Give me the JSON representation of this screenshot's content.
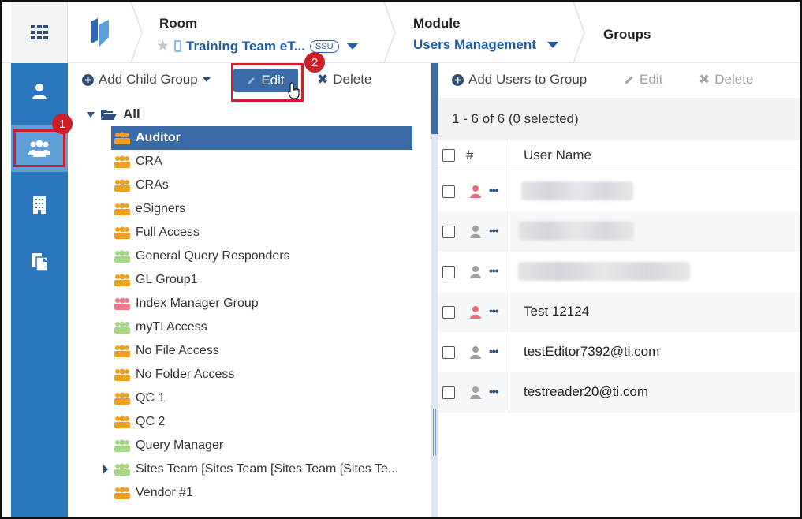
{
  "header": {
    "room_title": "Room",
    "room_value": "Training Team eT...",
    "room_badge": "SSU",
    "module_title": "Module",
    "module_value": "Users Management",
    "page_title": "Groups"
  },
  "badges": {
    "one": "1",
    "two": "2"
  },
  "tree_toolbar": {
    "add_child_group": "Add Child Group",
    "edit": "Edit",
    "delete": "Delete"
  },
  "tree": {
    "root": "All",
    "items": [
      {
        "label": "Auditor",
        "color": "#f0a020"
      },
      {
        "label": "CRA",
        "color": "#f0a020"
      },
      {
        "label": "CRAs",
        "color": "#f0a020"
      },
      {
        "label": "eSigners",
        "color": "#f0a020"
      },
      {
        "label": "Full Access",
        "color": "#f0a020"
      },
      {
        "label": "General Query Responders",
        "color": "#a6d782"
      },
      {
        "label": "GL Group1",
        "color": "#f0a020"
      },
      {
        "label": "Index Manager Group",
        "color": "#ef7b8a"
      },
      {
        "label": "myTI Access",
        "color": "#a6d782"
      },
      {
        "label": "No File Access",
        "color": "#f0a020"
      },
      {
        "label": "No Folder Access",
        "color": "#f0a020"
      },
      {
        "label": "QC 1",
        "color": "#f0a020"
      },
      {
        "label": "QC 2",
        "color": "#f0a020"
      },
      {
        "label": "Query Manager",
        "color": "#a6d782"
      },
      {
        "label": "Sites Team [Sites Team [Sites Team [Sites Te...",
        "color": "#a6d782"
      },
      {
        "label": "Vendor #1",
        "color": "#f0a020"
      }
    ]
  },
  "right_toolbar": {
    "add_users": "Add Users to Group",
    "edit": "Edit",
    "delete": "Delete"
  },
  "count_text": "1 - 6 of 6 (0 selected)",
  "table": {
    "col_hash": "#",
    "col_username": "User Name",
    "rows": [
      {
        "name": "",
        "icon_color": "#ef6b7a"
      },
      {
        "name": "",
        "icon_color": "#a0a0a0"
      },
      {
        "name": "",
        "icon_color": "#a0a0a0"
      },
      {
        "name": "Test 12124",
        "icon_color": "#ef6b7a"
      },
      {
        "name": "testEditor7392@ti.com",
        "icon_color": "#a0a0a0"
      },
      {
        "name": "testreader20@ti.com",
        "icon_color": "#a0a0a0"
      }
    ]
  },
  "colors": {
    "nav_blue": "#2a77bd",
    "accent_blue": "#1f5fa8",
    "selected_row": "#3a6aa8",
    "highlight_red": "#cc1f2a"
  }
}
